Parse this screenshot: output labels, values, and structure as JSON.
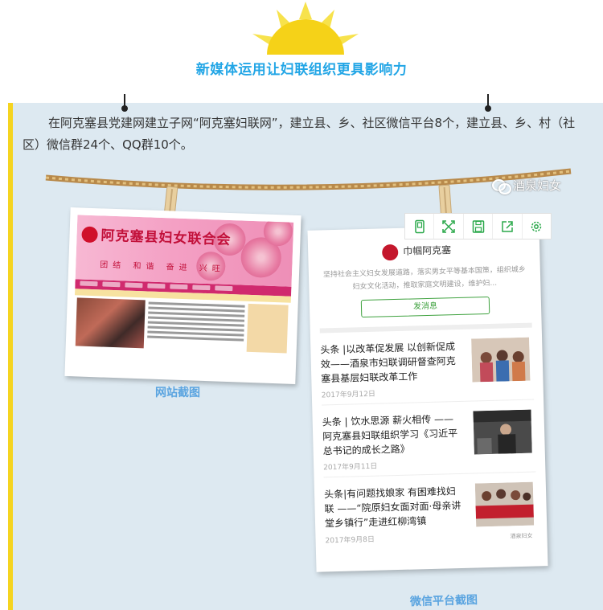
{
  "header": {
    "title": "新媒体运用让妇联组织更具影响力"
  },
  "body": {
    "paragraph": "在阿克塞县党建网建立子网“阿克塞妇联网”，建立县、乡、社区微信平台8个，建立县、乡、村（社区）微信群24个、QQ群10个。"
  },
  "watermark": {
    "text": "酒泉妇女"
  },
  "site_screenshot": {
    "site_name": "阿克塞县妇女联合会",
    "motto": "团结 和谐 奋进 兴旺",
    "caption": "网站截图"
  },
  "wechat_screenshot": {
    "account_name": "巾帼阿克塞",
    "description": "坚持社会主义妇女发展道路，落实男女平等基本国策，组织城乡妇女文化活动，推取家庭文明建设，维护妇...",
    "send_button": "发消息",
    "articles": [
      {
        "title": "头条 |以改革促发展 以创新促成效——酒泉市妇联调研督查阿克塞县基层妇联改革工作",
        "date": "2017年9月12日"
      },
      {
        "title": "头条 | 饮水思源 薪火相传 ——阿克塞县妇联组织学习《习近平总书记的成长之路》",
        "date": "2017年9月11日"
      },
      {
        "title": "头条|有问题找娘家 有困难找妇联 ——“院原妇女面对面·母亲讲堂乡镇行”走进红柳湾镇",
        "date": "2017年9月8日"
      }
    ],
    "footer_logo": "酒泉妇女",
    "caption": "微信平台截图"
  },
  "toolbar": {
    "items": [
      {
        "icon": "phone-preview-icon"
      },
      {
        "icon": "fullscreen-icon"
      },
      {
        "icon": "save-icon"
      },
      {
        "icon": "share-icon"
      },
      {
        "icon": "settings-icon"
      }
    ],
    "accent": "#2aa84a"
  },
  "colors": {
    "title": "#23a6e6",
    "panel_bg": "#dde9f1",
    "panel_border": "#f5d420",
    "caption": "#5aa4e0"
  }
}
